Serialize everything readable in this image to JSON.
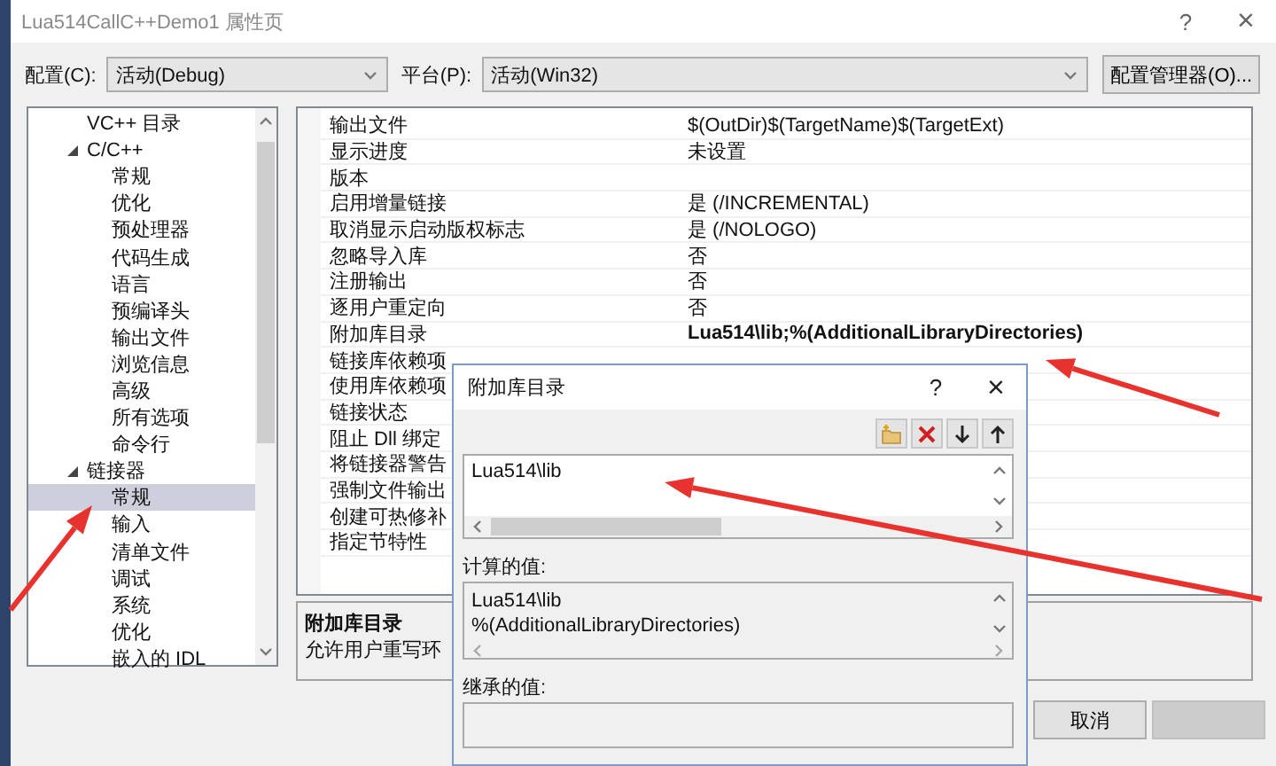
{
  "window": {
    "title": "Lua514CallC++Demo1 属性页",
    "help": "?",
    "close": "×"
  },
  "config_bar": {
    "config_label": "配置(C):",
    "config_value": "活动(Debug)",
    "platform_label": "平台(P):",
    "platform_value": "活动(Win32)",
    "manager_button": "配置管理器(O)..."
  },
  "tree": [
    {
      "label": "VC++ 目录",
      "selected": false
    },
    {
      "label": "C/C++",
      "expanded": true,
      "selected": false,
      "children": [
        {
          "label": "常规",
          "selected": false
        },
        {
          "label": "优化",
          "selected": false
        },
        {
          "label": "预处理器",
          "selected": false
        },
        {
          "label": "代码生成",
          "selected": false
        },
        {
          "label": "语言",
          "selected": false
        },
        {
          "label": "预编译头",
          "selected": false
        },
        {
          "label": "输出文件",
          "selected": false
        },
        {
          "label": "浏览信息",
          "selected": false
        },
        {
          "label": "高级",
          "selected": false
        },
        {
          "label": "所有选项",
          "selected": false
        },
        {
          "label": "命令行",
          "selected": false
        }
      ]
    },
    {
      "label": "链接器",
      "expanded": true,
      "selected": false,
      "children": [
        {
          "label": "常规",
          "selected": true
        },
        {
          "label": "输入",
          "selected": false
        },
        {
          "label": "清单文件",
          "selected": false
        },
        {
          "label": "调试",
          "selected": false
        },
        {
          "label": "系统",
          "selected": false
        },
        {
          "label": "优化",
          "selected": false
        },
        {
          "label": "嵌入的 IDL",
          "selected": false
        }
      ]
    }
  ],
  "properties": [
    {
      "name": "输出文件",
      "value": "$(OutDir)$(TargetName)$(TargetExt)",
      "modified": false
    },
    {
      "name": "显示进度",
      "value": "未设置",
      "modified": false
    },
    {
      "name": "版本"
    },
    {
      "name": "启用增量链接",
      "value": "是 (/INCREMENTAL)",
      "modified": false
    },
    {
      "name": "取消显示启动版权标志",
      "value": "是 (/NOLOGO)",
      "modified": false
    },
    {
      "name": "忽略导入库",
      "value": "否",
      "modified": false
    },
    {
      "name": "注册输出",
      "value": "否",
      "modified": false
    },
    {
      "name": "逐用户重定向",
      "value": "否",
      "modified": false
    },
    {
      "name": "附加库目录",
      "value": "Lua514\\lib;%(AdditionalLibraryDirectories)",
      "modified": true
    },
    {
      "name": "链接库依赖项"
    },
    {
      "name": "使用库依赖项"
    },
    {
      "name": "链接状态"
    },
    {
      "name": "阻止 Dll 绑定"
    },
    {
      "name": "将链接器警告"
    },
    {
      "name": "强制文件输出"
    },
    {
      "name": "创建可热修补"
    },
    {
      "name": "指定节特性"
    }
  ],
  "description": {
    "title": "附加库目录",
    "text": "允许用户重写环"
  },
  "buttons": [
    {
      "label": "取消",
      "disabled": false
    },
    {
      "disabled": true
    }
  ],
  "dialog": {
    "title": "附加库目录",
    "help": "?",
    "close": "×",
    "entries": [
      "Lua514\\lib"
    ],
    "computed_label": "计算的值:",
    "computed_lines": [
      "Lua514\\lib",
      "%(AdditionalLibraryDirectories)"
    ],
    "inherited_label": "继承的值:"
  }
}
